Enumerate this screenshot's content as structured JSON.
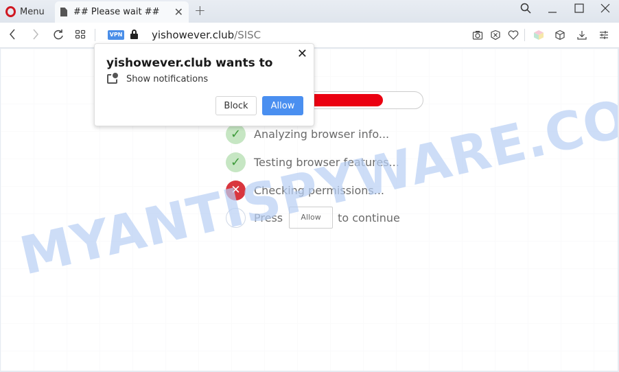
{
  "browser": {
    "menu_label": "Menu",
    "tab_title": "## Please wait ##",
    "vpn_badge": "VPN",
    "url_domain": "yishowever.club",
    "url_path": "/SISC",
    "icons": {
      "opera_logo": "opera-logo-icon",
      "tab_page": "document-icon",
      "tab_close": "close-icon",
      "new_tab": "plus-icon",
      "search": "search-icon",
      "minimize": "minimize-icon",
      "maximize": "maximize-icon",
      "window_close": "close-icon",
      "back": "chevron-left-icon",
      "forward": "chevron-right-icon",
      "reload": "reload-icon",
      "speed_dial": "grid-icon",
      "lock": "lock-icon",
      "snapshot": "camera-icon",
      "adblock": "shield-x-icon",
      "bookmark": "heart-icon",
      "extension": "cube-colored-icon",
      "extensions": "cube-icon",
      "downloads": "download-icon",
      "easy_setup": "sliders-icon"
    }
  },
  "popup": {
    "title": "yishowever.club wants to",
    "permission": "Show notifications",
    "block_label": "Block",
    "allow_label": "Allow",
    "close_glyph": "✕"
  },
  "page": {
    "progress_percent": 76,
    "progress_color": "#eb0011",
    "steps": [
      {
        "status": "done",
        "text": "Analyzing browser info..."
      },
      {
        "status": "done",
        "text": "Testing browser features..."
      },
      {
        "status": "failed",
        "text": "Checking permissions..."
      },
      {
        "status": "pending",
        "text_before": "Press",
        "button": "Allow",
        "text_after": "to continue"
      }
    ],
    "watermark": "MYANTISPYWARE.COM"
  },
  "colors": {
    "allow_blue": "#4a8ff0",
    "success_green": "#3d9a3a",
    "error_red": "#d9363e",
    "opera_red": "#d01822"
  }
}
